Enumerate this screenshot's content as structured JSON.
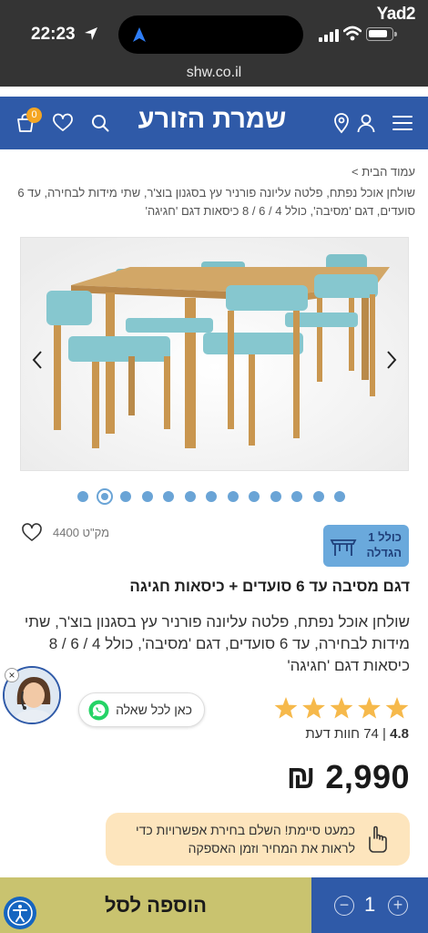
{
  "status_bar": {
    "time": "22:23",
    "watermark": "Yad2",
    "url": "shw.co.il"
  },
  "header": {
    "logo": "שמרת הזורע",
    "cart_count": "0",
    "brand_color": "#2f5aa8"
  },
  "breadcrumb": {
    "home": "עמוד הבית >",
    "current": "שולחן אוכל נפתח, פלטה עליונה פורניר עץ בסגנון בוצ'ר, שתי מידות לבחירה, עד 6 סועדים, דגם 'מסיבה', כולל 4 / 6 / 8 כיסאות דגם 'חגיגה'"
  },
  "gallery": {
    "dot_count": 13,
    "active_dot": 1
  },
  "product": {
    "sku": "מק\"ט 4400",
    "assembly_badge": "כולל 1 הגדלה",
    "title": "דגם מסיבה עד 6 סועדים + כיסאות חגיגה",
    "description": "שולחן אוכל נפתח, פלטה עליונה פורניר עץ בסגנון בוצ'ר, שתי מידות לבחירה, עד 6 סועדים, דגם 'מסיבה', כולל 4 / 6 / 8 כיסאות דגם 'חגיגה'",
    "rating_value": "4.8",
    "rating_count": "74 חוות דעת",
    "rating_stars": 5,
    "price": "2,990 ₪"
  },
  "chat": {
    "label": "כאן לכל שאלה"
  },
  "notice": {
    "text": "כמעט סיימת! השלם בחירת אפשרויות כדי לראות את המחיר וזמן האספקה"
  },
  "bottom_bar": {
    "add_to_cart": "הוספה לסל",
    "quantity": "1",
    "minus": "−",
    "plus": "+"
  }
}
